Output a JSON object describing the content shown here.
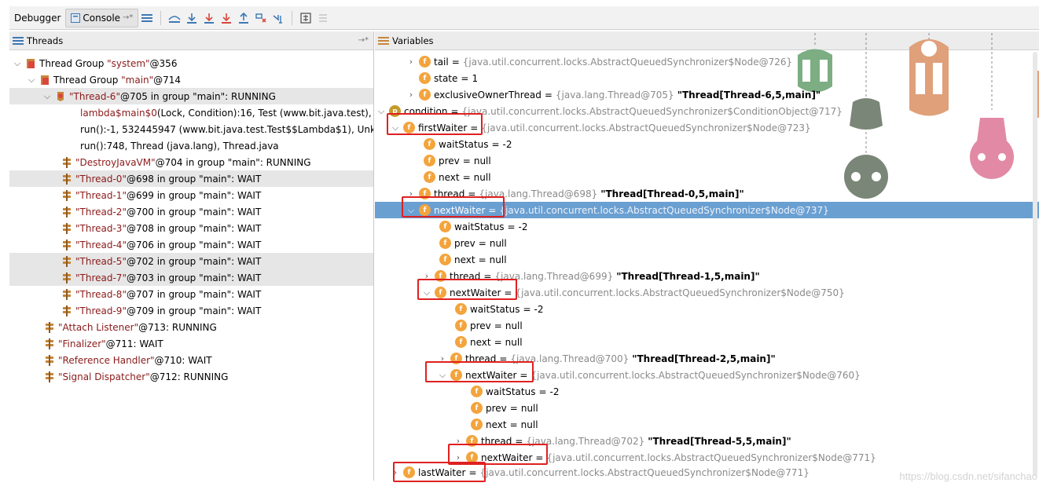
{
  "toolbar": {
    "debugger_label": "Debugger",
    "console_label": "Console",
    "console_pin": "→*"
  },
  "threads": {
    "header": "Threads",
    "rows": [
      {
        "lead": "Thread Group ",
        "name": "\"system\"",
        "rest": "@356"
      },
      {
        "lead": "Thread Group ",
        "name": "\"main\"",
        "rest": "@714"
      },
      {
        "name": "\"Thread-6\"",
        "rest": "@705 in group \"main\": RUNNING"
      },
      {
        "name": "lambda$main$0",
        "rest": "(Lock, Condition):16, Test (www.bit.java.test), Te"
      },
      {
        "name": "run",
        "rest": "():-1, 532445947 (www.bit.java.test.Test$$Lambda$1), Unknc"
      },
      {
        "name": "run",
        "rest": "():748, Thread (java.lang), Thread.java"
      },
      {
        "name": "\"DestroyJavaVM\"",
        "rest": "@704 in group \"main\": RUNNING"
      },
      {
        "name": "\"Thread-0\"",
        "rest": "@698 in group \"main\": WAIT"
      },
      {
        "name": "\"Thread-1\"",
        "rest": "@699 in group \"main\": WAIT"
      },
      {
        "name": "\"Thread-2\"",
        "rest": "@700 in group \"main\": WAIT"
      },
      {
        "name": "\"Thread-3\"",
        "rest": "@708 in group \"main\": WAIT"
      },
      {
        "name": "\"Thread-4\"",
        "rest": "@706 in group \"main\": WAIT"
      },
      {
        "name": "\"Thread-5\"",
        "rest": "@702 in group \"main\": WAIT"
      },
      {
        "name": "\"Thread-7\"",
        "rest": "@703 in group \"main\": WAIT"
      },
      {
        "name": "\"Thread-8\"",
        "rest": "@707 in group \"main\": WAIT"
      },
      {
        "name": "\"Thread-9\"",
        "rest": "@709 in group \"main\": WAIT"
      },
      {
        "name": "\"Attach Listener\"",
        "rest": "@713: RUNNING"
      },
      {
        "name": "\"Finalizer\"",
        "rest": "@711: WAIT"
      },
      {
        "name": "\"Reference Handler\"",
        "rest": "@710: WAIT"
      },
      {
        "name": "\"Signal Dispatcher\"",
        "rest": "@712: RUNNING"
      }
    ]
  },
  "variables": {
    "header": "Variables",
    "rows": [
      {
        "name": "tail",
        "val": "{java.util.concurrent.locks.AbstractQueuedSynchronizer$Node@726}",
        "extra": ""
      },
      {
        "name": "state",
        "val": "1",
        "extra": ""
      },
      {
        "name": "exclusiveOwnerThread",
        "val": "{java.lang.Thread@705}",
        "extra": "\"Thread[Thread-6,5,main]\""
      },
      {
        "name": "condition",
        "val": "{java.util.concurrent.locks.AbstractQueuedSynchronizer$ConditionObject@717}",
        "extra": ""
      },
      {
        "name": "firstWaiter",
        "val": "{java.util.concurrent.locks.AbstractQueuedSynchronizer$Node@723}",
        "extra": ""
      },
      {
        "name": "waitStatus",
        "val": "-2",
        "extra": ""
      },
      {
        "name": "prev",
        "val": "null",
        "extra": ""
      },
      {
        "name": "next",
        "val": "null",
        "extra": ""
      },
      {
        "name": "thread",
        "val": "{java.lang.Thread@698}",
        "extra": "\"Thread[Thread-0,5,main]\""
      },
      {
        "name": "nextWaiter",
        "val": "{java.util.concurrent.locks.AbstractQueuedSynchronizer$Node@737}",
        "extra": ""
      },
      {
        "name": "waitStatus",
        "val": "-2",
        "extra": ""
      },
      {
        "name": "prev",
        "val": "null",
        "extra": ""
      },
      {
        "name": "next",
        "val": "null",
        "extra": ""
      },
      {
        "name": "thread",
        "val": "{java.lang.Thread@699}",
        "extra": "\"Thread[Thread-1,5,main]\""
      },
      {
        "name": "nextWaiter",
        "val": "{java.util.concurrent.locks.AbstractQueuedSynchronizer$Node@750}",
        "extra": ""
      },
      {
        "name": "waitStatus",
        "val": "-2",
        "extra": ""
      },
      {
        "name": "prev",
        "val": "null",
        "extra": ""
      },
      {
        "name": "next",
        "val": "null",
        "extra": ""
      },
      {
        "name": "thread",
        "val": "{java.lang.Thread@700}",
        "extra": "\"Thread[Thread-2,5,main]\""
      },
      {
        "name": "nextWaiter",
        "val": "{java.util.concurrent.locks.AbstractQueuedSynchronizer$Node@760}",
        "extra": ""
      },
      {
        "name": "waitStatus",
        "val": "-2",
        "extra": ""
      },
      {
        "name": "prev",
        "val": "null",
        "extra": ""
      },
      {
        "name": "next",
        "val": "null",
        "extra": ""
      },
      {
        "name": "thread",
        "val": "{java.lang.Thread@702}",
        "extra": "\"Thread[Thread-5,5,main]\""
      },
      {
        "name": "nextWaiter",
        "val": "{java.util.concurrent.locks.AbstractQueuedSynchronizer$Node@771}",
        "extra": ""
      },
      {
        "name": "lastWaiter",
        "val": "{java.util.concurrent.locks.AbstractQueuedSynchronizer$Node@771}",
        "extra": ""
      }
    ]
  },
  "watermark": "https://blog.csdn.net/sifanchao",
  "colors": {
    "selection": "#6a9fd2",
    "annotation_red": "#e02020",
    "field_icon": "#f3a43c",
    "thread_name": "#8b1a1a"
  }
}
